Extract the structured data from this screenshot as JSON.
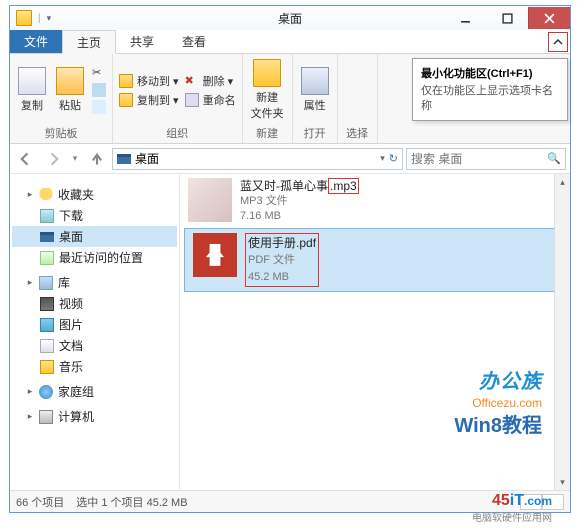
{
  "title": "桌面",
  "tabs": {
    "file": "文件",
    "home": "主页",
    "share": "共享",
    "view": "查看"
  },
  "ribbon": {
    "clipboard": {
      "copy": "复制",
      "paste": "粘贴",
      "label": "剪贴板"
    },
    "organize": {
      "moveTo": "移动到 ▾",
      "copyTo": "复制到 ▾",
      "delete": "删除 ▾",
      "rename": "重命名",
      "label": "组织"
    },
    "new": {
      "newFolder": "新建\n文件夹",
      "label": "新建"
    },
    "open": {
      "properties": "属性",
      "label": "打开"
    },
    "select": {
      "label": "选择"
    }
  },
  "tooltip": {
    "title": "最小化功能区(Ctrl+F1)",
    "body": "仅在功能区上显示选项卡名称"
  },
  "address": {
    "location": "桌面"
  },
  "search": {
    "placeholder": "搜索 桌面"
  },
  "sidebar": {
    "favorites": "收藏夹",
    "downloads": "下载",
    "desktop": "桌面",
    "recent": "最近访问的位置",
    "libraries": "库",
    "videos": "视频",
    "pictures": "图片",
    "documents": "文档",
    "music": "音乐",
    "homegroup": "家庭组",
    "computer": "计算机"
  },
  "files": [
    {
      "name": "蓝又时-孤单心事",
      "ext": ".mp3",
      "type": "MP3 文件",
      "size": "7.16 MB"
    },
    {
      "name": "使用手册",
      "ext": ".pdf",
      "type": "PDF 文件",
      "size": "45.2 MB"
    }
  ],
  "status": {
    "count": "66 个项目",
    "selection": "选中 1 个项目 45.2 MB"
  },
  "watermarks": {
    "w1": "办公族",
    "w1b": "Officezu.com",
    "w2": "Win8教程",
    "w3a": "45",
    "w3b": "iT",
    "w3c": ".com",
    "w3sub": "电脑软硬件应用网"
  }
}
